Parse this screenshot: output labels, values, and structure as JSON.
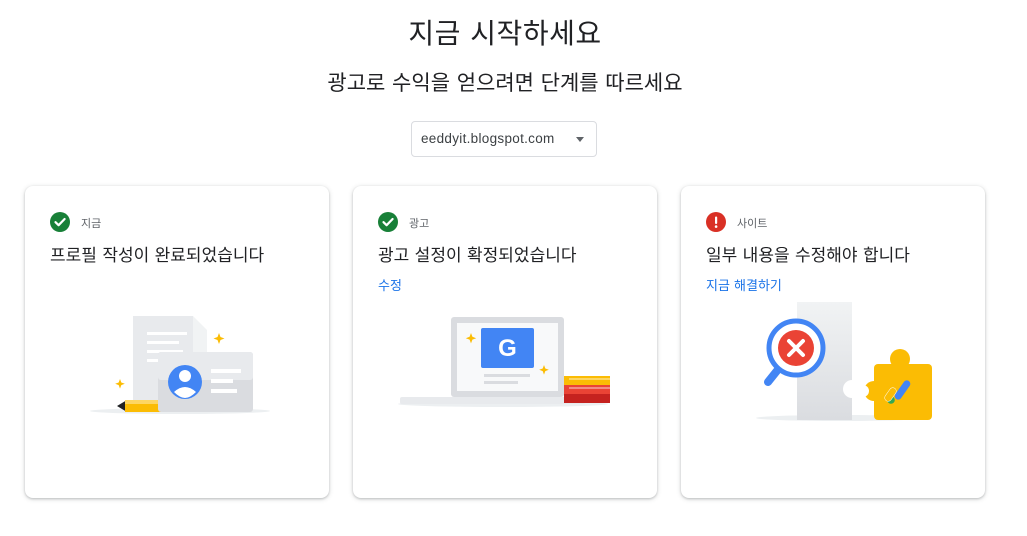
{
  "header": {
    "title": "지금 시작하세요",
    "subtitle": "광고로 수익을 얻으려면 단계를 따르세요"
  },
  "site_selector": {
    "selected": "eeddyit.blogspot.com"
  },
  "cards": [
    {
      "step_label": "지금",
      "status": "complete",
      "status_icon": "check-circle-icon",
      "heading": "프로필 작성이 완료되었습니다",
      "link": null,
      "illustration": "profile-card-illustration"
    },
    {
      "step_label": "광고",
      "status": "complete",
      "status_icon": "check-circle-icon",
      "heading": "광고 설정이 확정되었습니다",
      "link": "수정",
      "illustration": "laptop-google-illustration"
    },
    {
      "step_label": "사이트",
      "status": "warning",
      "status_icon": "error-circle-icon",
      "heading": "일부 내용을 수정해야 합니다",
      "link": "지금 해결하기",
      "illustration": "puzzle-magnifier-illustration"
    }
  ],
  "colors": {
    "success": "#188038",
    "error": "#d93025",
    "link": "#1a73e8",
    "google_blue": "#4285f4",
    "google_yellow": "#fbbc04",
    "google_red": "#ea4335",
    "google_green": "#34a853"
  }
}
